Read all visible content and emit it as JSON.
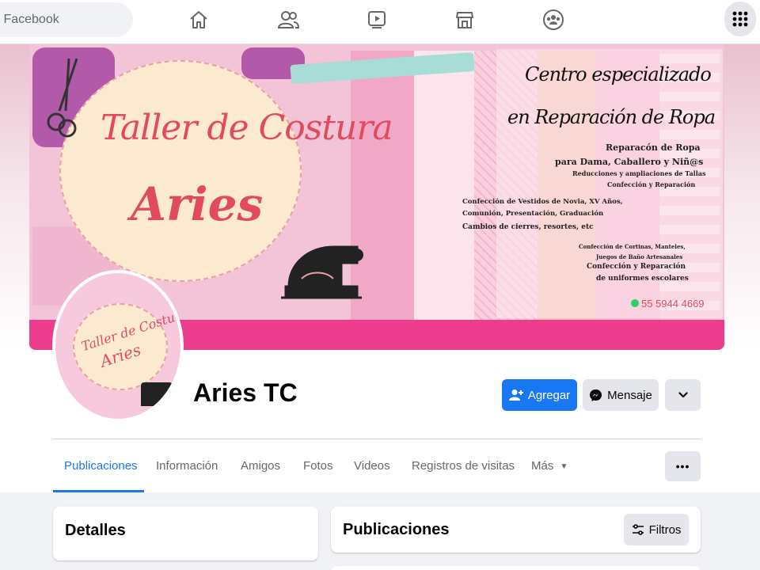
{
  "topbar": {
    "search_placeholder": "Facebook",
    "nav_icons": [
      "home-icon",
      "friends-icon",
      "watch-icon",
      "marketplace-icon",
      "groups-icon"
    ],
    "menu_icon": "grid-menu-icon"
  },
  "cover": {
    "title": "Taller de Costura",
    "subtitle": "Aries",
    "heading_line1": "Centro especializado",
    "heading_line2": "en Reparación de Ropa",
    "services": [
      "Reparacón de Ropa",
      "para Dama, Caballero y Niñ@s",
      "Reducciones y ampliaciones de Tallas",
      "Confección y Reparación",
      "Confección de Vestidos de Novia, XV Años,",
      "Comunión, Presentación, Graduación",
      "Cambios de cierres, resortes, etc",
      "Confección de Cortinas, Manteles,",
      "Juegos de Baño Artesanales",
      "Confección y Reparación",
      "de uniformes escolares"
    ],
    "phone": "55 5944 4669"
  },
  "avatar": {
    "line1": "Taller de Costura",
    "line2": "Aries"
  },
  "profile": {
    "name": "Aries TC",
    "add_friend_label": "Agregar",
    "message_label": "Mensaje"
  },
  "tabs": [
    {
      "label": "Publicaciones",
      "active": true
    },
    {
      "label": "Información"
    },
    {
      "label": "Amigos"
    },
    {
      "label": "Fotos"
    },
    {
      "label": "Videos"
    },
    {
      "label": "Registros de visitas"
    },
    {
      "label": "Más"
    }
  ],
  "details_card": {
    "title": "Detalles"
  },
  "posts_card": {
    "title": "Publicaciones",
    "filters_label": "Filtros"
  },
  "colors": {
    "primary": "#1877f2",
    "cover_accent": "#ec3d8f",
    "cover_text": "#e14b5d"
  }
}
